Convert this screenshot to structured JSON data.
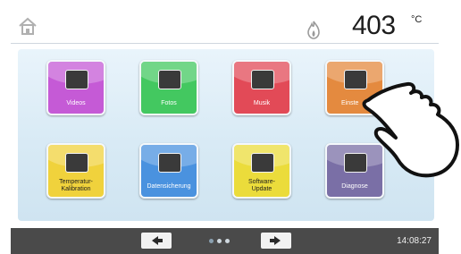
{
  "header": {
    "temperature": "403",
    "unit": "°C",
    "icons": [
      "home-icon",
      "flame-icon"
    ]
  },
  "tiles": [
    {
      "label": "Videos",
      "icon": "video-icon",
      "color": "#c55ad6"
    },
    {
      "label": "Fotos",
      "icon": "photo-icon",
      "color": "#43c860"
    },
    {
      "label": "Musik",
      "icon": "music-icon",
      "color": "#e24a57"
    },
    {
      "label": "Einste",
      "icon": "tools-icon",
      "color": "#e48a3f"
    },
    {
      "label": "Temperatur-\nKalibration",
      "icon": "calibration-icon",
      "color": "#f0d23c"
    },
    {
      "label": "Datensicherung",
      "icon": "backup-icon",
      "color": "#4a92df"
    },
    {
      "label": "Software-\nUpdate",
      "icon": "chip-icon",
      "color": "#ebdc3b"
    },
    {
      "label": "Diagnose",
      "icon": "diagnosis-icon",
      "color": "#7a6fa6"
    }
  ],
  "footer": {
    "time": "14:08:27",
    "prev": "◀",
    "next": "▶",
    "page_dots": 3,
    "active_dot": 0
  },
  "colors": {
    "panel": "#dcecf6",
    "footer": "#4a4a4a"
  }
}
